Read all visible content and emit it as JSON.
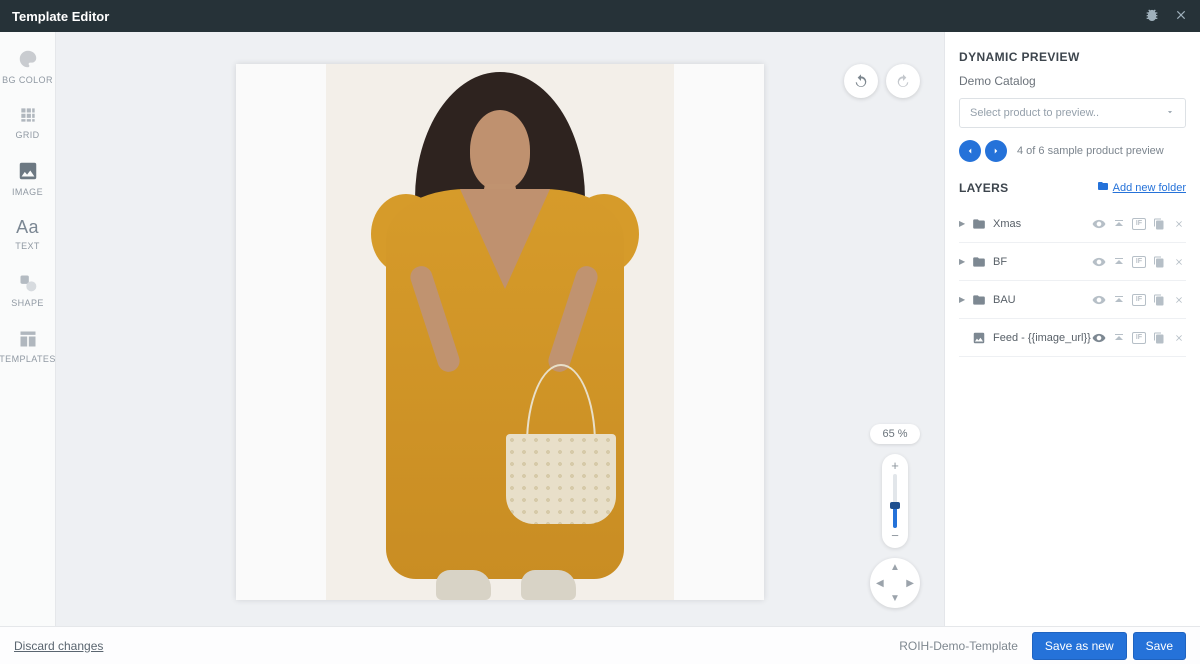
{
  "topbar": {
    "title": "Template Editor"
  },
  "sidebar": {
    "tools": [
      {
        "id": "bgcolor",
        "label": "BG COLOR"
      },
      {
        "id": "grid",
        "label": "GRID"
      },
      {
        "id": "image",
        "label": "IMAGE"
      },
      {
        "id": "text",
        "label": "TEXT",
        "glyph": "Aa"
      },
      {
        "id": "shape",
        "label": "SHAPE"
      },
      {
        "id": "templates",
        "label": "TEMPLATES"
      }
    ]
  },
  "canvas": {
    "zoom_percent": "65 %"
  },
  "preview": {
    "heading": "DYNAMIC PREVIEW",
    "catalog": "Demo Catalog",
    "select_placeholder": "Select product to preview..",
    "sample_text": "4 of 6 sample product preview"
  },
  "layers": {
    "heading": "LAYERS",
    "add_folder": "Add new folder",
    "items": [
      {
        "name": "Xmas",
        "type": "folder",
        "visible": false
      },
      {
        "name": "BF",
        "type": "folder",
        "visible": false
      },
      {
        "name": "BAU",
        "type": "folder",
        "visible": false
      },
      {
        "name": "Feed - {{image_url}}",
        "type": "feed",
        "visible": true
      }
    ]
  },
  "footer": {
    "discard": "Discard changes",
    "template_name": "ROIH-Demo-Template",
    "save_new": "Save as new",
    "save": "Save"
  }
}
